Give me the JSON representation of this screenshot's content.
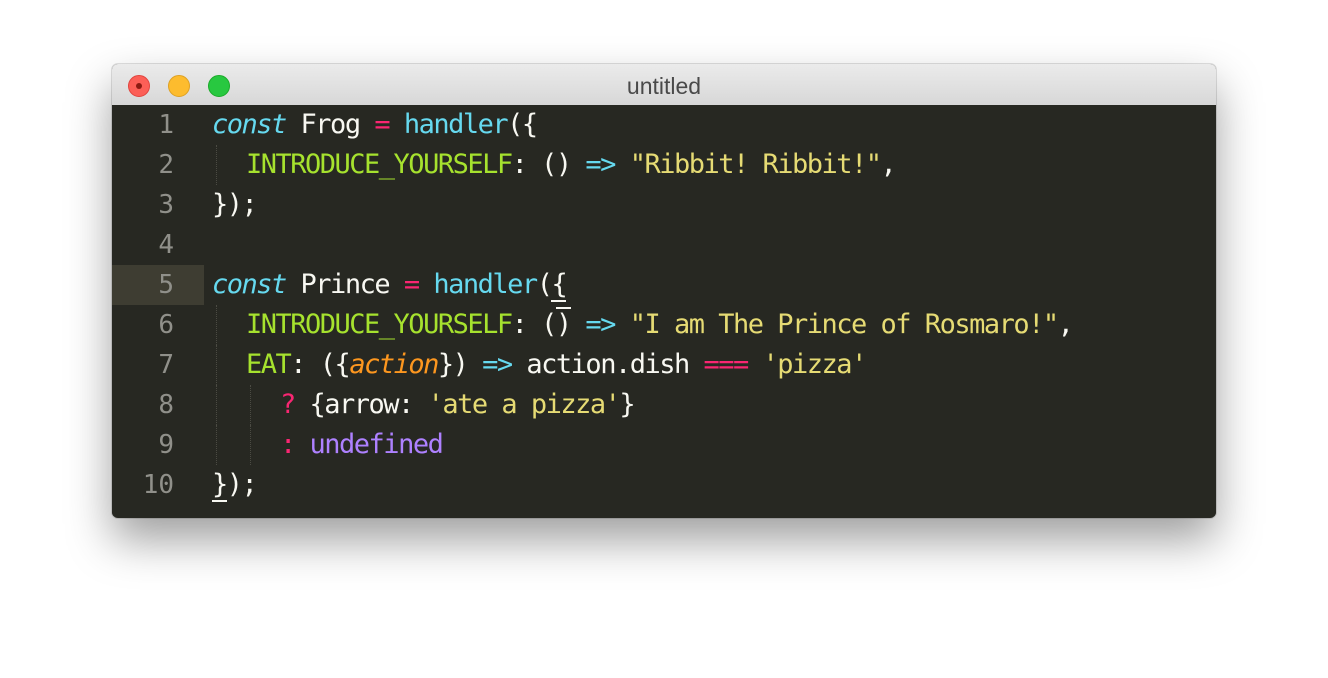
{
  "window": {
    "title": "untitled"
  },
  "editor": {
    "line_numbers": [
      "1",
      "2",
      "3",
      "4",
      "5",
      "6",
      "7",
      "8",
      "9",
      "10"
    ],
    "active_line": "5",
    "tokens": {
      "l1": [
        "const",
        " ",
        "Frog",
        " ",
        "=",
        " ",
        "handler",
        "({"
      ],
      "l2": [
        "INTRODUCE_YOURSELF",
        ": ",
        "()",
        " ",
        "=>",
        " ",
        "\"Ribbit! Ribbit!\"",
        ","
      ],
      "l3": [
        "});"
      ],
      "l5": [
        "const",
        " ",
        "Prince",
        " ",
        "=",
        " ",
        "handler",
        "(",
        "{"
      ],
      "l6": [
        "INTRODUCE_YOURSELF",
        ": ",
        "(",
        ")",
        " ",
        "=>",
        " ",
        "\"I am The Prince of Rosmaro!\"",
        ","
      ],
      "l7": [
        "EAT",
        ": ({",
        "action",
        "}) ",
        "=>",
        " action.dish ",
        "===",
        " ",
        "'pizza'"
      ],
      "l8": [
        "?",
        " {arrow: ",
        "'ate a pizza'",
        "}"
      ],
      "l9": [
        ":",
        " ",
        "undefined"
      ],
      "l10": [
        "}",
        ");"
      ]
    }
  },
  "colors": {
    "background": "#272822",
    "keyword": "#66d9ef",
    "operator": "#f92672",
    "string": "#e6db74",
    "property": "#a6e22e",
    "parameter": "#fd971f",
    "constant": "#ae81ff",
    "text": "#f8f8f2"
  }
}
